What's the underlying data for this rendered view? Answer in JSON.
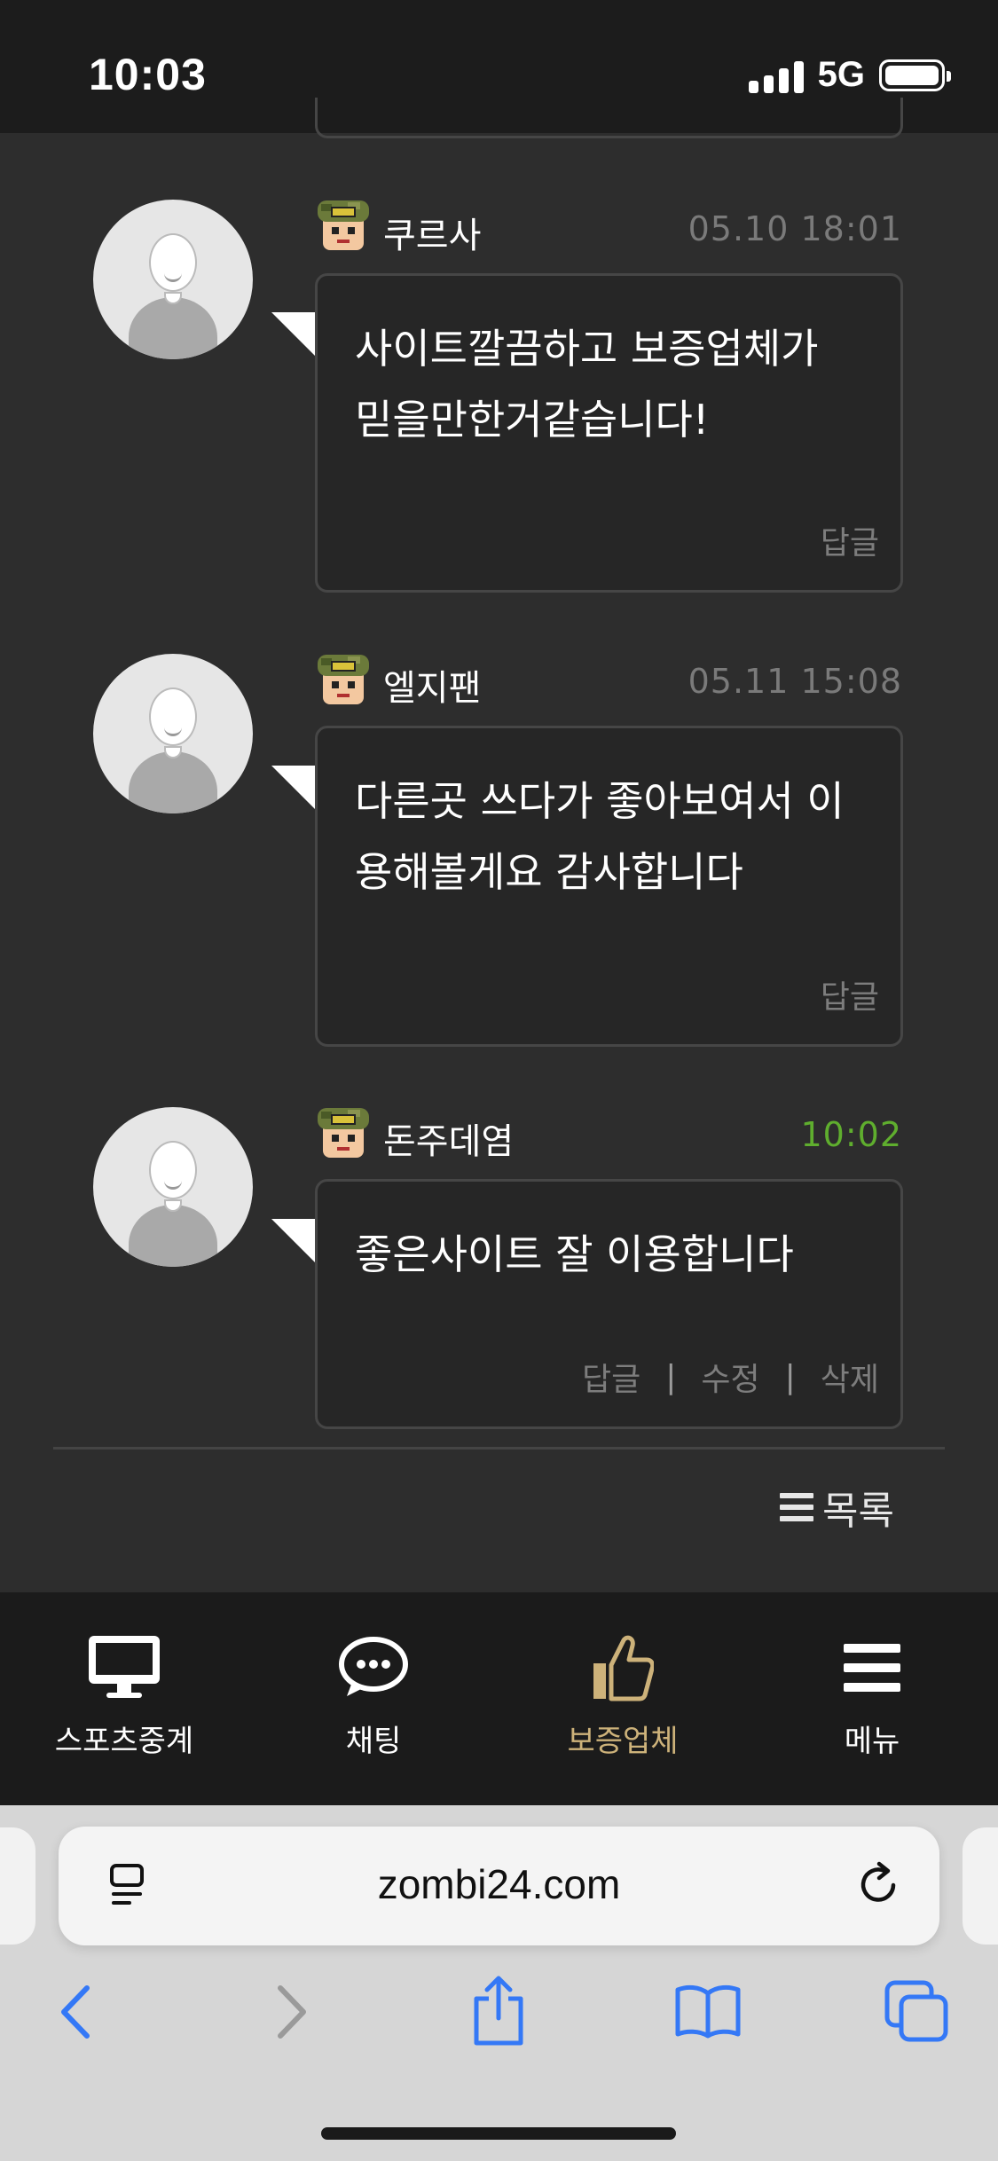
{
  "status_bar": {
    "time": "10:03",
    "network": "5G"
  },
  "comments": [
    {
      "nickname": "쿠르사",
      "date": "05.10 18:01",
      "text": "사이트깔끔하고 보증업체가 믿을만한거같습니다!",
      "actions": [
        "답글"
      ]
    },
    {
      "nickname": "엘지팬",
      "date": "05.11 15:08",
      "text": "다른곳 쓰다가 좋아보여서 이용해볼게요 감사합니다",
      "actions": [
        "답글"
      ]
    },
    {
      "nickname": "돈주데염",
      "date": "10:02",
      "text": "좋은사이트 잘 이용합니다",
      "actions": [
        "답글",
        "수정",
        "삭제"
      ],
      "date_color": "#5fae2e"
    }
  ],
  "separator": "|",
  "list_button": {
    "label": "목록",
    "icon": "list-icon"
  },
  "bottom_nav": {
    "items": [
      {
        "label": "스포츠중계",
        "icon": "monitor-icon",
        "active": false
      },
      {
        "label": "채팅",
        "icon": "chat-bubble-icon",
        "active": false
      },
      {
        "label": "보증업체",
        "icon": "thumbs-up-icon",
        "active": true
      },
      {
        "label": "메뉴",
        "icon": "hamburger-icon",
        "active": false
      }
    ],
    "active_color": "#cdb27a"
  },
  "browser": {
    "url": "zombi24.com",
    "toolbar": [
      "back-icon",
      "forward-icon",
      "share-icon",
      "bookmarks-icon",
      "tabs-icon"
    ],
    "accent": "#3478f6"
  }
}
